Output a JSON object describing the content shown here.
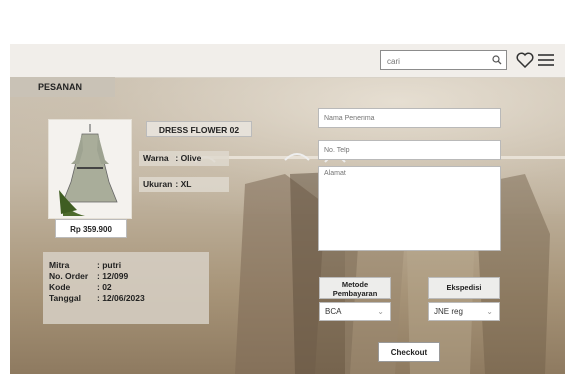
{
  "header": {
    "search": {
      "placeholder": "cari"
    },
    "icons": [
      "search-icon",
      "heart-icon",
      "menu-icon"
    ]
  },
  "page": {
    "tab_label": "PESANAN"
  },
  "product": {
    "name": "DRESS FLOWER 02",
    "price": "Rp 359.900",
    "image_icon": "dress-image",
    "color_label": "Warna",
    "color_value": ": Olive",
    "size_label": "Ukuran",
    "size_value": ": XL"
  },
  "order": {
    "rows": [
      {
        "label": "Mitra",
        "value": ": putri"
      },
      {
        "label": "No. Order",
        "value": ": 12/099"
      },
      {
        "label": "Kode",
        "value": ": 02"
      },
      {
        "label": "Tanggal",
        "value": ": 12/06/2023"
      }
    ]
  },
  "form": {
    "name_placeholder": "Nama Penerima",
    "phone_placeholder": "No. Telp",
    "address_placeholder": "Alamat",
    "payment_label": "Metode Pembayaran",
    "payment_value": "BCA",
    "shipping_label": "Ekspedisi",
    "shipping_value": "JNE reg",
    "checkout_label": "Checkout"
  },
  "colors": {
    "background": "#c4b8a5",
    "topbar": "#f1eeea",
    "panel": "#ffffff"
  }
}
